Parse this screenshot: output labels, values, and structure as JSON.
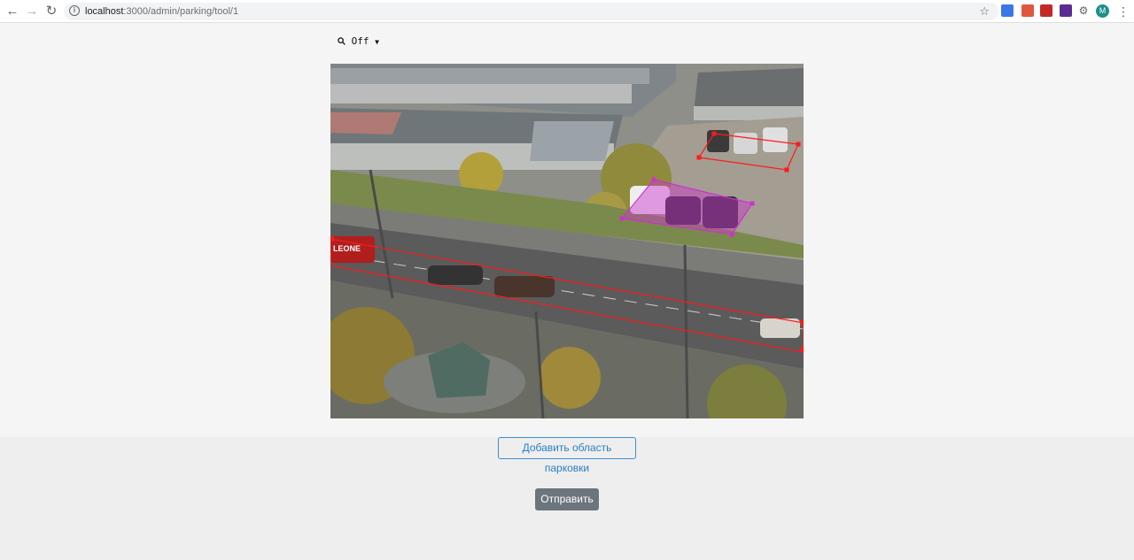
{
  "browser": {
    "url_host": "localhost",
    "url_path": ":3000/admin/parking/tool/1",
    "profile_initial": "M"
  },
  "toolbar": {
    "zoom_label": "Off"
  },
  "actions": {
    "add_area_label": "Добавить область парковки",
    "submit_label": "Отправить"
  },
  "image": {
    "camera_watermark": "LEONE"
  },
  "colors": {
    "accent_blue": "#2a7fc4",
    "submit_gray": "#6c757d",
    "zone_red": "#ff1a1a",
    "zone_selected": "#cc33cc"
  }
}
